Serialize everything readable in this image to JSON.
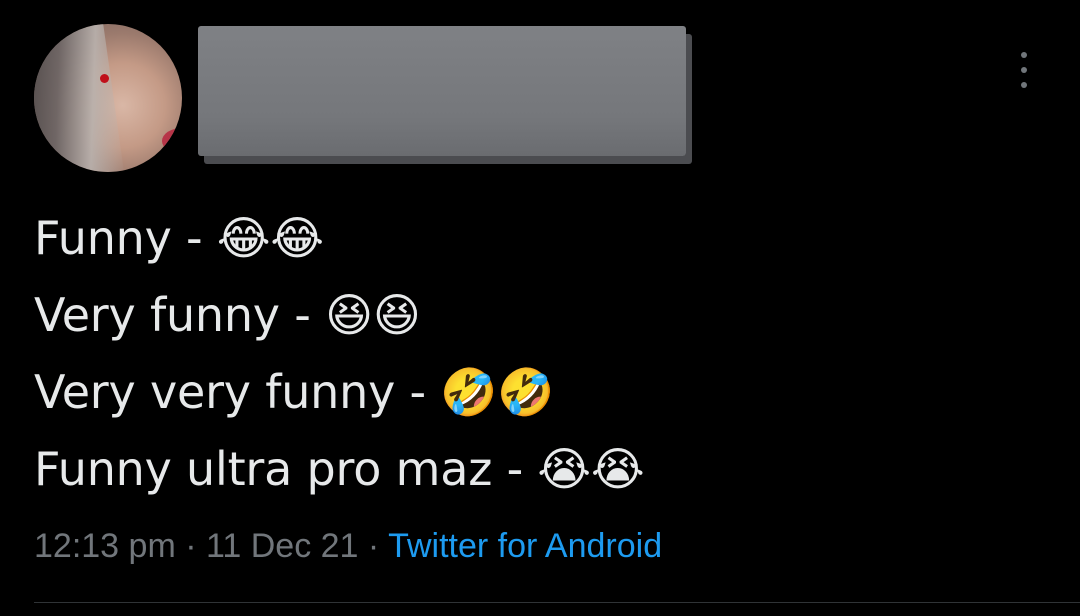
{
  "tweet": {
    "author": {
      "avatar_icon": "profile-photo"
    },
    "more_icon": "more-vertical-icon",
    "lines": [
      "Funny - 😂😂",
      "Very funny - 😆😆",
      "Very very funny - 🤣🤣",
      "Funny ultra pro maz - 😭😭"
    ],
    "meta": {
      "time": "12:13 pm",
      "separator": "·",
      "date": "11 Dec 21",
      "source": "Twitter for Android"
    }
  },
  "colors": {
    "background": "#000000",
    "text": "#e7e9ea",
    "muted": "#71767b",
    "link": "#1d9bf0",
    "divider": "#2f3336"
  }
}
